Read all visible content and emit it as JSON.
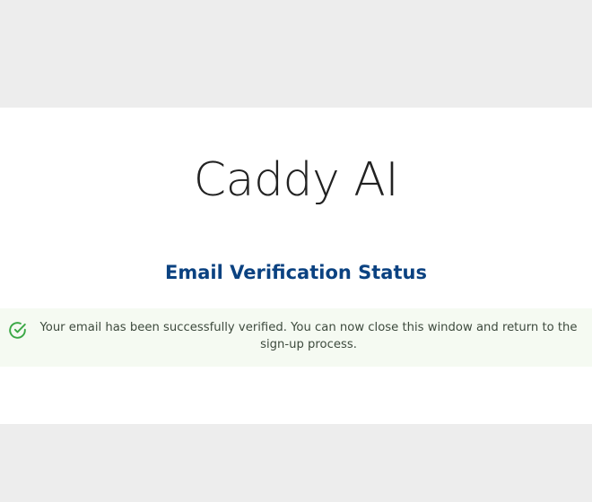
{
  "card": {
    "brand_title": "Caddy AI",
    "heading": "Email Verification Status",
    "alert": {
      "icon": "check-circle-icon",
      "message": "Your email has been successfully verified. You can now close this window and return to the sign-up process."
    }
  },
  "colors": {
    "page_background": "#ededed",
    "card_background": "#ffffff",
    "heading": "#0b4281",
    "alert_background": "#f5faf2",
    "success_icon": "#3aa845"
  }
}
